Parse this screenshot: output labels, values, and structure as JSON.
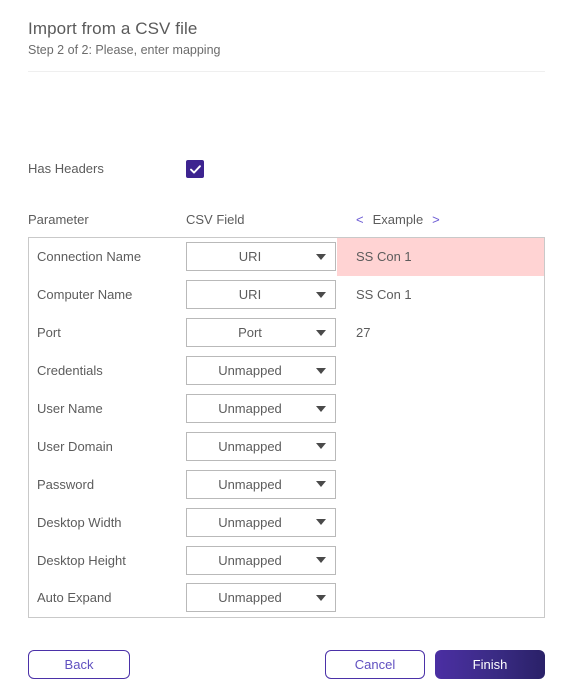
{
  "header": {
    "title": "Import from a CSV file",
    "subtitle": "Step 2 of 2: Please, enter mapping"
  },
  "options": {
    "has_headers_label": "Has Headers",
    "has_headers_checked": true,
    "checkbox_icon": "checkmark-icon",
    "accent_color": "#3d2490"
  },
  "columns": {
    "parameter": "Parameter",
    "csv_field": "CSV Field",
    "example": "Example",
    "prev_arrow": "<",
    "next_arrow": ">",
    "arrow_color": "#6c5bd4"
  },
  "mapping_rows": [
    {
      "parameter": "Connection Name",
      "required": true,
      "csv_field": "URI",
      "example": "SS Con 1",
      "highlight": true,
      "highlight_color": "#ffd3d3"
    },
    {
      "parameter": "Computer Name",
      "required": true,
      "csv_field": "URI",
      "example": "SS Con 1",
      "highlight": false,
      "highlight_color": ""
    },
    {
      "parameter": "Port",
      "required": false,
      "csv_field": "Port",
      "example": "27",
      "highlight": false,
      "highlight_color": ""
    },
    {
      "parameter": "Credentials",
      "required": false,
      "csv_field": "Unmapped",
      "example": "",
      "highlight": false,
      "highlight_color": ""
    },
    {
      "parameter": "User Name",
      "required": false,
      "csv_field": "Unmapped",
      "example": "",
      "highlight": false,
      "highlight_color": ""
    },
    {
      "parameter": "User Domain",
      "required": false,
      "csv_field": "Unmapped",
      "example": "",
      "highlight": false,
      "highlight_color": ""
    },
    {
      "parameter": "Password",
      "required": false,
      "csv_field": "Unmapped",
      "example": "",
      "highlight": false,
      "highlight_color": ""
    },
    {
      "parameter": "Desktop Width",
      "required": false,
      "csv_field": "Unmapped",
      "example": "",
      "highlight": false,
      "highlight_color": ""
    },
    {
      "parameter": "Desktop Height",
      "required": false,
      "csv_field": "Unmapped",
      "example": "",
      "highlight": false,
      "highlight_color": ""
    },
    {
      "parameter": "Auto Expand",
      "required": false,
      "csv_field": "Unmapped",
      "example": "",
      "highlight": false,
      "highlight_color": ""
    }
  ],
  "required_marker": "*",
  "footer": {
    "back_label": "Back",
    "cancel_label": "Cancel",
    "finish_label": "Finish"
  }
}
